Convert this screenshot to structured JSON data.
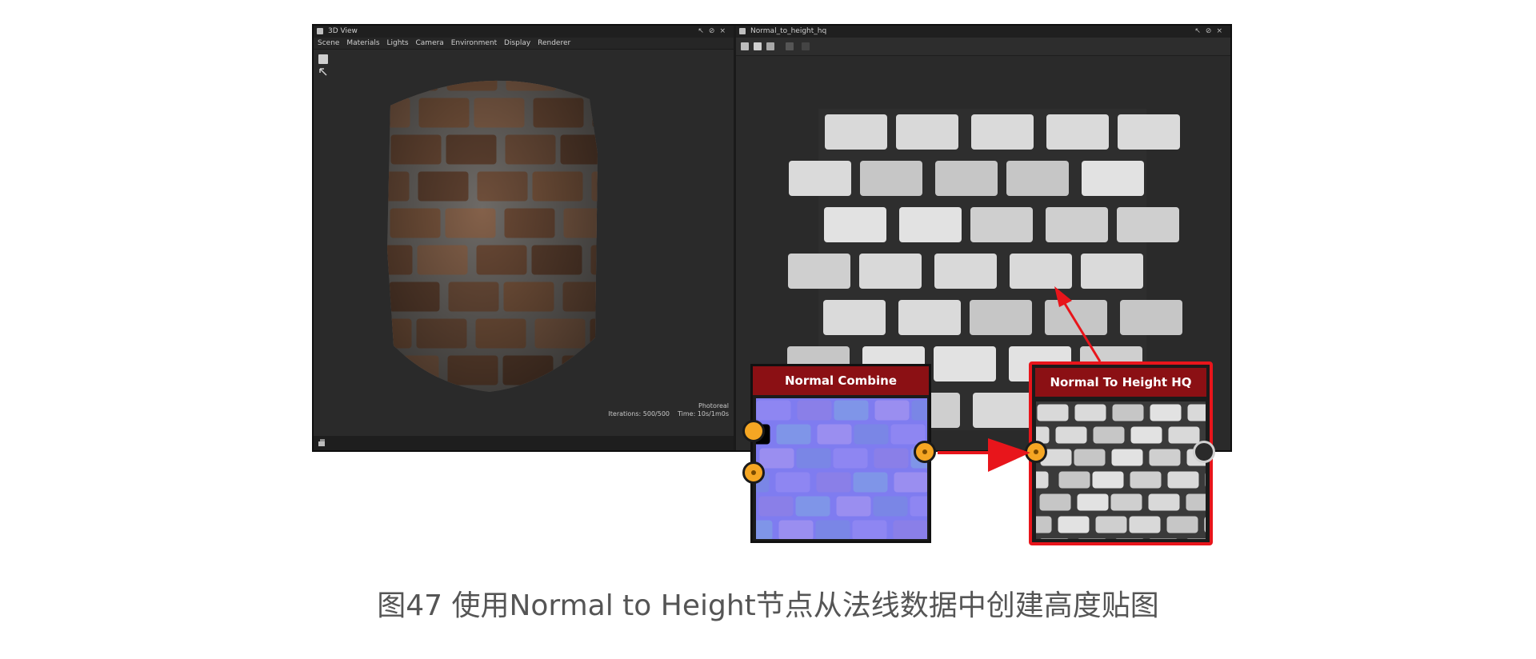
{
  "panel_3d": {
    "title": "3D View",
    "menu": [
      "Scene",
      "Materials",
      "Lights",
      "Camera",
      "Environment",
      "Display",
      "Renderer"
    ],
    "render_mode": "Photoreal",
    "iterations": "Iterations: 500/500",
    "time": "Time: 10s/1m0s"
  },
  "panel_2d": {
    "title": "Normal_to_height_hq"
  },
  "nodes": {
    "normal_combine": {
      "title": "Normal Combine"
    },
    "normal_to_height": {
      "title": "Normal To Height HQ"
    }
  },
  "colors": {
    "node_header": "#8b1014",
    "highlight": "#e8151b",
    "port": "#f5a623",
    "caption": "#555555"
  },
  "icons": [
    "window-icon",
    "pin-icon",
    "float-icon",
    "close-icon",
    "select-tool-icon",
    "arrow-tool-icon"
  ],
  "caption": "图47 使用Normal to Height节点从法线数据中创建高度贴图"
}
